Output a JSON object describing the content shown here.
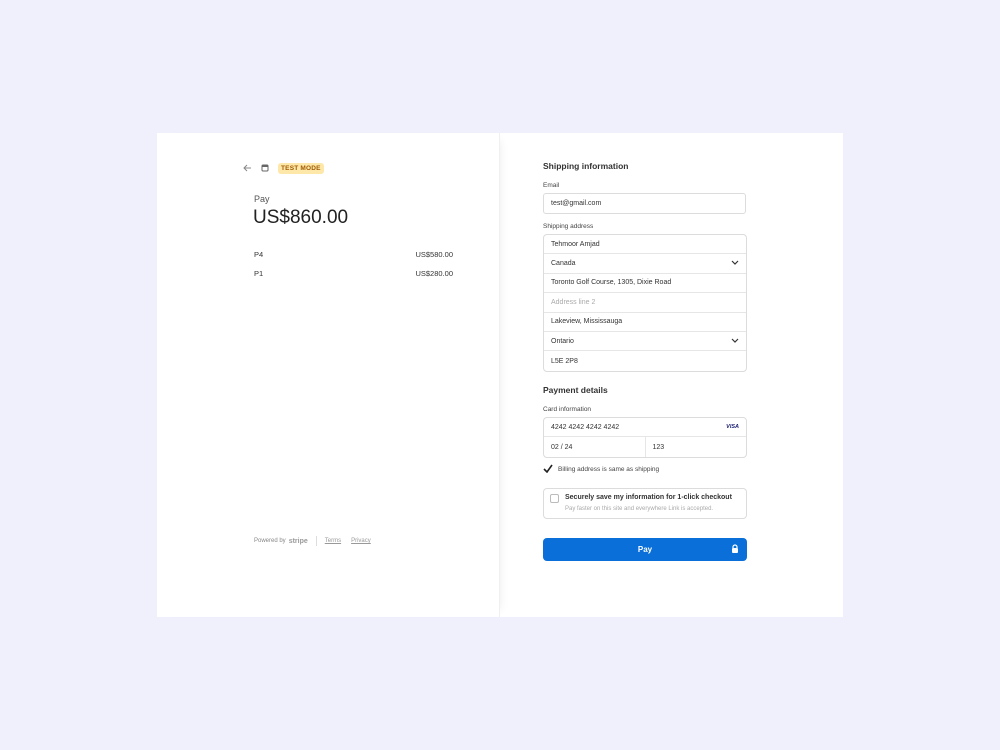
{
  "header": {
    "badge": "TEST MODE"
  },
  "summary": {
    "pay_label": "Pay",
    "amount": "US$860.00",
    "items": [
      {
        "name": "P4",
        "price": "US$580.00"
      },
      {
        "name": "P1",
        "price": "US$280.00"
      }
    ]
  },
  "footer": {
    "powered_by": "Powered by",
    "brand": "stripe",
    "terms": "Terms",
    "privacy": "Privacy"
  },
  "shipping": {
    "title": "Shipping information",
    "email_label": "Email",
    "email_value": "test@gmail.com",
    "address_label": "Shipping address",
    "name": "Tehmoor Amjad",
    "country": "Canada",
    "address_line1": "Toronto Golf Course, 1305, Dixie Road",
    "address_line2_placeholder": "Address line 2",
    "city": "Lakeview, Mississauga",
    "province": "Ontario",
    "postal_code": "L5E 2P8"
  },
  "payment": {
    "title": "Payment details",
    "card_label": "Card information",
    "card_number": "4242 4242 4242 4242",
    "card_brand": "VISA",
    "expiry": "02 / 24",
    "cvc": "123",
    "billing_same": "Billing address is same as shipping",
    "save_title": "Securely save my information for 1-click checkout",
    "save_subtitle": "Pay faster on this site and everywhere Link is accepted.",
    "pay_button": "Pay"
  },
  "colors": {
    "accent": "#0a6fd8",
    "background": "#f0f0fc",
    "badge_bg": "#fde7a9"
  }
}
